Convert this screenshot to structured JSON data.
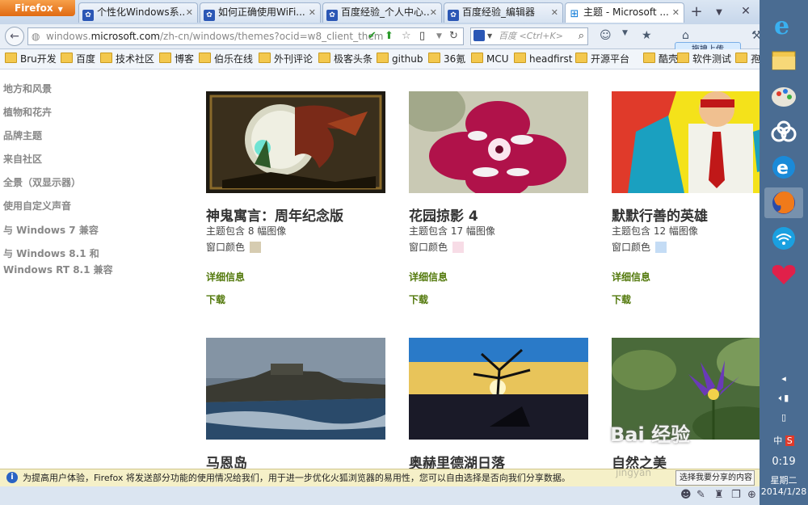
{
  "browser": {
    "menu_button": "Firefox",
    "tabs": [
      {
        "label": "个性化Windows系..."
      },
      {
        "label": "如何正确使用WiFi..."
      },
      {
        "label": "百度经验_个人中心..."
      },
      {
        "label": "百度经验_编辑器"
      },
      {
        "label": "主题 - Microsoft ..."
      }
    ],
    "new_tab": "+",
    "url_prefix": "windows.",
    "url_domain": "microsoft.com",
    "url_rest": "/zh-cn/windows/themes?ocid=w8_client_them",
    "search_placeholder": "百度 <Ctrl+K>",
    "upload_tip": "拖拽上传"
  },
  "bookmarks": [
    {
      "label": "Bru开发"
    },
    {
      "label": "百度"
    },
    {
      "label": "技术社区"
    },
    {
      "label": "博客"
    },
    {
      "label": "伯乐在线"
    },
    {
      "label": "外刊评论"
    },
    {
      "label": "极客头条"
    },
    {
      "label": "github"
    },
    {
      "label": "36氪"
    },
    {
      "label": "MCU"
    },
    {
      "label": "headfirst"
    },
    {
      "label": "开源平台"
    },
    {
      "label": "酷壳"
    },
    {
      "label": "软件测试"
    },
    {
      "label": "孢子"
    }
  ],
  "sidebar": {
    "items": [
      {
        "label": "地方和风景"
      },
      {
        "label": "植物和花卉"
      },
      {
        "label": "品牌主题"
      },
      {
        "label": "来自社区"
      },
      {
        "label": "全景（双显示器）"
      },
      {
        "label": "使用自定义声音"
      },
      {
        "label": "与 Windows 7 兼容"
      },
      {
        "label": "与 Windows 8.1 和"
      },
      {
        "label": "Windows RT 8.1 兼容"
      }
    ]
  },
  "cards": [
    {
      "title": "神鬼寓言：周年纪念版",
      "meta": "主题包含 8 幅图像",
      "color_label": "窗口颜色",
      "color": "#d6ccb1",
      "details": "详细信息",
      "download": "下载"
    },
    {
      "title": "花园掠影 4",
      "meta": "主题包含 17 幅图像",
      "color_label": "窗口颜色",
      "color": "#f7dce6",
      "details": "详细信息",
      "download": "下载"
    },
    {
      "title": "默默行善的英雄",
      "meta": "主题包含 12 幅图像",
      "color_label": "窗口颜色",
      "color": "#c4dcf5",
      "details": "详细信息",
      "download": "下载"
    },
    {
      "title": "马恩岛"
    },
    {
      "title": "奥赫里德湖日落"
    },
    {
      "title": "自然之美"
    }
  ],
  "notification": {
    "text": "为提高用户体验，Firefox 将发送部分功能的使用情况给我们，用于进一步优化火狐浏览器的易用性，您可以自由选择是否向我们分享数据。",
    "button": "选择我要分享的内容"
  },
  "taskbar": {
    "time": "0:19",
    "weekday": "星期二",
    "date": "2014/1/28",
    "ime": "中"
  },
  "watermark": {
    "text": "Bai 经验",
    "url": "jingyan"
  },
  "colors": {
    "link_green": "#53790c",
    "taskbar_blue": "#4a6c92",
    "firefox_orange": "#e06a12"
  }
}
